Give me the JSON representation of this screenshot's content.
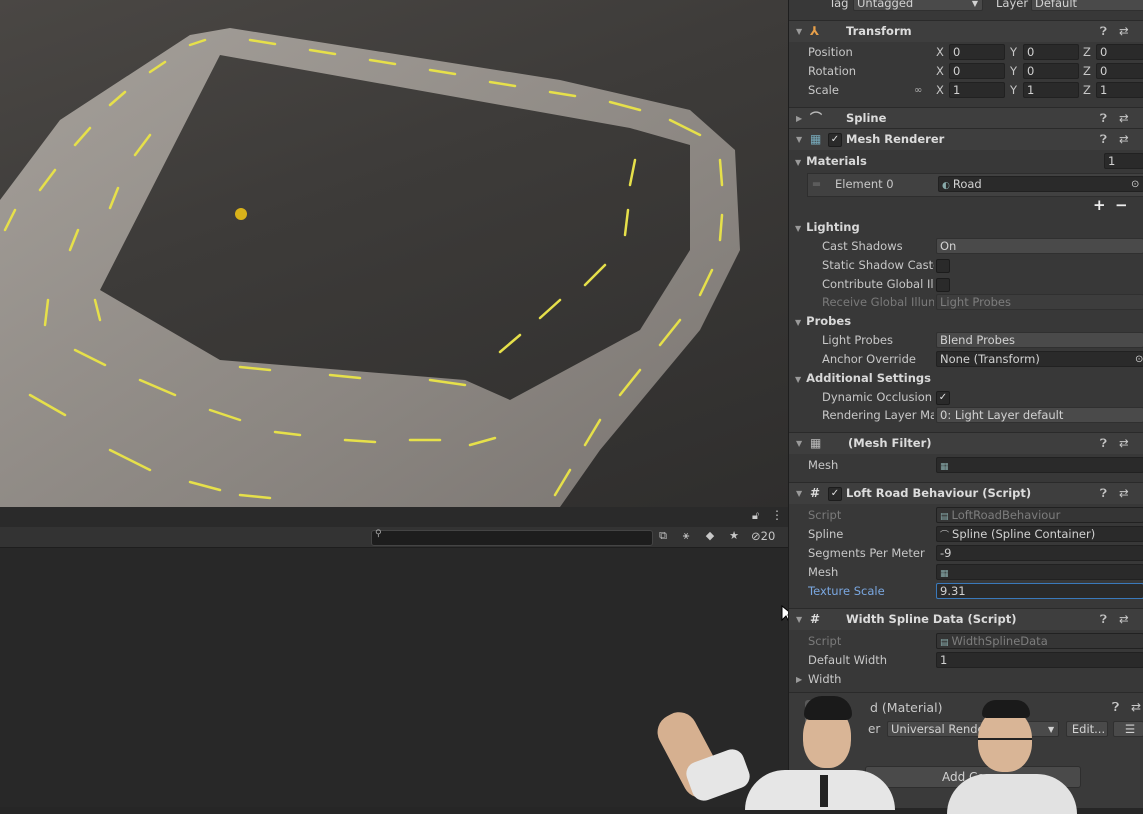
{
  "top": {
    "tag_label": "Tag",
    "tag_value": "Untagged",
    "layer_label": "Layer",
    "layer_value": "Default"
  },
  "transform": {
    "title": "Transform",
    "position": {
      "label": "Position",
      "x": "0",
      "y": "0",
      "z": "0"
    },
    "rotation": {
      "label": "Rotation",
      "x": "0",
      "y": "0",
      "z": "0"
    },
    "scale": {
      "label": "Scale",
      "x": "1",
      "y": "1",
      "z": "1"
    },
    "axis_x": "X",
    "axis_y": "Y",
    "axis_z": "Z"
  },
  "spline_component": {
    "title": "Spline"
  },
  "mesh_renderer": {
    "title": "Mesh Renderer",
    "materials_label": "Materials",
    "materials_count": "1",
    "element0_label": "Element 0",
    "element0_value": "Road",
    "add": "+",
    "remove": "−",
    "lighting_label": "Lighting",
    "cast_shadows_label": "Cast Shadows",
    "cast_shadows_value": "On",
    "static_shadow_label": "Static Shadow Caste",
    "contribute_gi_label": "Contribute Global Illu",
    "receive_gi_label": "Receive Global Illumi",
    "receive_gi_value": "Light Probes",
    "probes_label": "Probes",
    "light_probes_label": "Light Probes",
    "light_probes_value": "Blend Probes",
    "anchor_label": "Anchor Override",
    "anchor_value": "None (Transform)",
    "additional_label": "Additional Settings",
    "dynamic_occlusion_label": "Dynamic Occlusion",
    "rendering_layer_label": "Rendering Layer Mas",
    "rendering_layer_value": "0: Light Layer default"
  },
  "mesh_filter": {
    "title": "(Mesh Filter)",
    "mesh_label": "Mesh"
  },
  "loft_road": {
    "title": "Loft Road Behaviour (Script)",
    "script_label": "Script",
    "script_value": "LoftRoadBehaviour",
    "spline_label": "Spline",
    "spline_value": "Spline (Spline Container)",
    "segments_label": "Segments Per Meter",
    "segments_value": "-9",
    "mesh_label": "Mesh",
    "texture_scale_label": "Texture Scale",
    "texture_scale_value": "9.31"
  },
  "width_spline": {
    "title": "Width Spline Data (Script)",
    "script_label": "Script",
    "script_value": "WidthSplineData",
    "default_width_label": "Default Width",
    "default_width_value": "1",
    "width_label": "Width"
  },
  "material_preview": {
    "title": "d (Material)",
    "shader_prefix": "er",
    "shader_value": "Universal Render",
    "edit_label": "Edit..."
  },
  "add_component": "Add Comp",
  "lower_panel": {
    "hidden_count": "20"
  },
  "colors": {
    "inspector_bg": "#383838",
    "scene_road": "#8f8a85",
    "lane_marking": "#e6e04a",
    "accent_blue": "#3a79bb"
  }
}
